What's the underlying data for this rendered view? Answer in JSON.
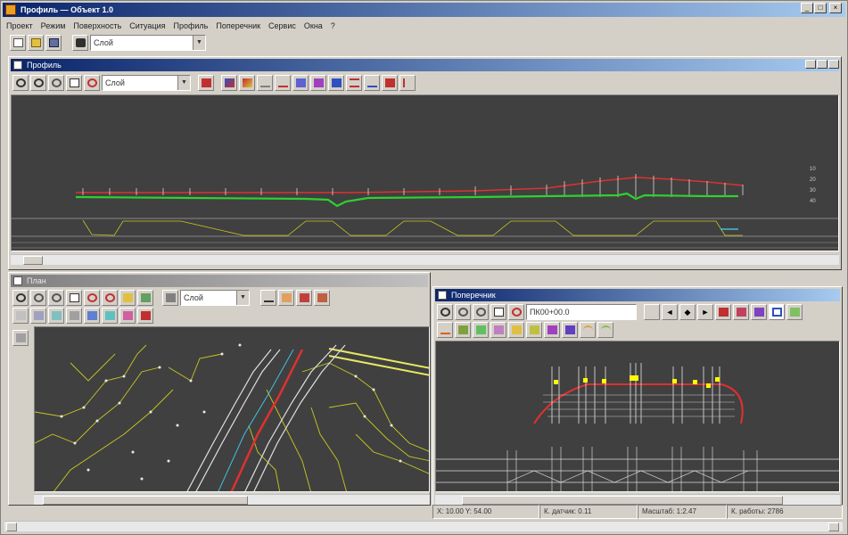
{
  "app": {
    "title": "Профиль — Объект 1.0",
    "menu": [
      "Проект",
      "Режим",
      "Поверхность",
      "Ситуация",
      "Профиль",
      "Поперечник",
      "Сервис",
      "Окна",
      "?"
    ]
  },
  "main_toolbar": {
    "layer_select": "Слой"
  },
  "profile_window": {
    "title": "Профиль",
    "layer_select": "Слой"
  },
  "plan_window": {
    "title": "План",
    "layer_select": "Слой"
  },
  "cross_window": {
    "title": "Поперечник",
    "station_select": "ПК00+00.0"
  },
  "status": {
    "coords": "X: 10.00  Y: 54.00",
    "pk": "К. датчик: 0.11",
    "zoom": "Масштаб: 1:2.47",
    "work": "К. работы: 2786"
  },
  "colors": {
    "canvas_bg": "#404040",
    "ground_line": "#2fd12f",
    "design_line": "#e03030",
    "plan_lines": "#c8c820",
    "road_axis": "#e03030"
  }
}
